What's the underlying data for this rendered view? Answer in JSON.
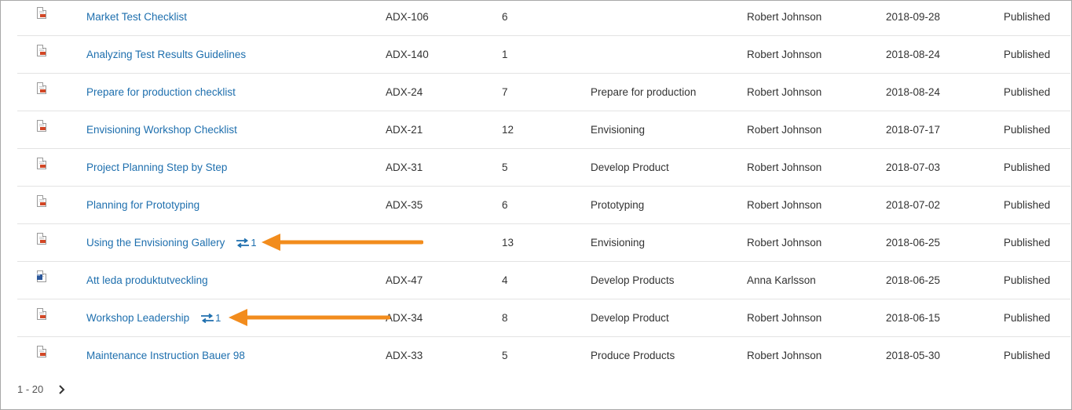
{
  "documents": [
    {
      "title": "Market Test Checklist",
      "id": "ADX-106",
      "version": "6",
      "phase": "",
      "author": "Robert Johnson",
      "date": "2018-09-28",
      "status": "Published",
      "type": "pdf-icon",
      "links": ""
    },
    {
      "title": "Analyzing Test Results Guidelines",
      "id": "ADX-140",
      "version": "1",
      "phase": "",
      "author": "Robert Johnson",
      "date": "2018-08-24",
      "status": "Published",
      "type": "pdf-icon",
      "links": ""
    },
    {
      "title": "Prepare for production checklist",
      "id": "ADX-24",
      "version": "7",
      "phase": "Prepare for production",
      "author": "Robert Johnson",
      "date": "2018-08-24",
      "status": "Published",
      "type": "pdf-icon",
      "links": ""
    },
    {
      "title": "Envisioning Workshop Checklist",
      "id": "ADX-21",
      "version": "12",
      "phase": "Envisioning",
      "author": "Robert Johnson",
      "date": "2018-07-17",
      "status": "Published",
      "type": "pdf-icon",
      "links": ""
    },
    {
      "title": "Project Planning Step by Step",
      "id": "ADX-31",
      "version": "5",
      "phase": "Develop Product",
      "author": "Robert Johnson",
      "date": "2018-07-03",
      "status": "Published",
      "type": "pdf-icon",
      "links": ""
    },
    {
      "title": "Planning for Prototyping",
      "id": "ADX-35",
      "version": "6",
      "phase": "Prototyping",
      "author": "Robert Johnson",
      "date": "2018-07-02",
      "status": "Published",
      "type": "pdf-icon",
      "links": ""
    },
    {
      "title": "Using the Envisioning Gallery",
      "id": "",
      "version": "13",
      "phase": "Envisioning",
      "author": "Robert Johnson",
      "date": "2018-06-25",
      "status": "Published",
      "type": "pdf-icon",
      "links": "1"
    },
    {
      "title": "Att leda produktutveckling",
      "id": "ADX-47",
      "version": "4",
      "phase": "Develop Products",
      "author": "Anna Karlsson",
      "date": "2018-06-25",
      "status": "Published",
      "type": "word-icon",
      "links": ""
    },
    {
      "title": "Workshop Leadership",
      "id": "ADX-34",
      "version": "8",
      "phase": "Develop Product",
      "author": "Robert Johnson",
      "date": "2018-06-15",
      "status": "Published",
      "type": "pdf-icon",
      "links": "1"
    },
    {
      "title": "Maintenance Instruction Bauer 98",
      "id": "ADX-33",
      "version": "5",
      "phase": "Produce Products",
      "author": "Robert Johnson",
      "date": "2018-05-30",
      "status": "Published",
      "type": "pdf-icon",
      "links": ""
    }
  ],
  "pager": {
    "range": "1 - 20",
    "next_icon": "chevron-right-icon"
  },
  "colors": {
    "link": "#1e6fae",
    "annotation_arrow": "#f28c1d",
    "pdf_badge": "#d24726",
    "word_badge": "#2b579a"
  }
}
